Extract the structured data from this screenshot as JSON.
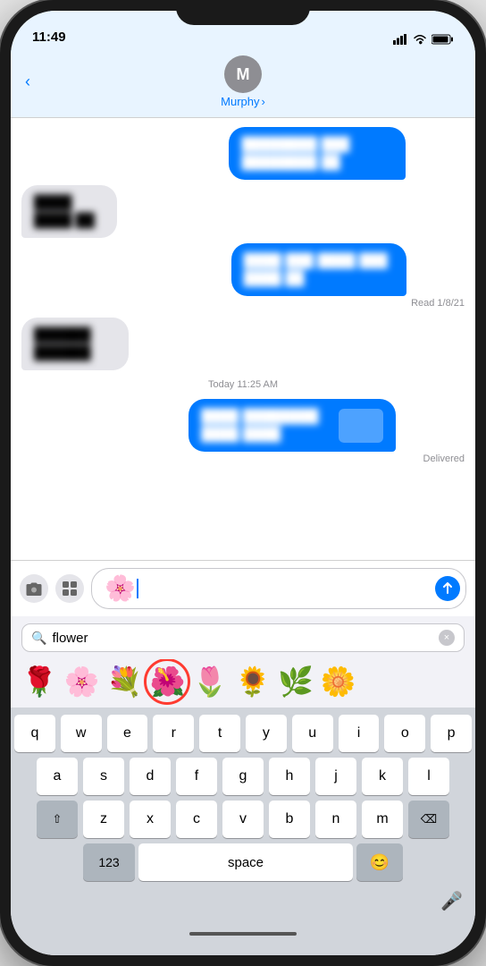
{
  "status": {
    "time": "11:49",
    "signal": "signal",
    "wifi": "wifi",
    "battery": "battery"
  },
  "nav": {
    "back_label": "‹",
    "avatar_letter": "M",
    "contact_name": "Murphy",
    "name_arrow": "›"
  },
  "messages": [
    {
      "id": 1,
      "type": "sent",
      "blurred": true,
      "text": "blurred sent message 1"
    },
    {
      "id": 2,
      "type": "received",
      "blurred": true,
      "text": "blurred received message 1"
    },
    {
      "id": 3,
      "type": "sent",
      "blurred": true,
      "text": "blurred sent message 2"
    },
    {
      "id": 4,
      "type": "meta",
      "text": "Read 1/8/21"
    },
    {
      "id": 5,
      "type": "received",
      "blurred": true,
      "text": "blurred received message 2"
    },
    {
      "id": 6,
      "type": "meta_center",
      "text": "Today 11:25 AM"
    },
    {
      "id": 7,
      "type": "sent",
      "blurred": true,
      "text": "blurred sent message 3 long"
    },
    {
      "id": 8,
      "type": "delivered",
      "text": "Delivered"
    }
  ],
  "compose": {
    "flower_emoji": "🌸",
    "send_icon": "↑"
  },
  "compose_icons": {
    "camera_icon": "⊙",
    "appstore_icon": "A"
  },
  "emoji_search": {
    "placeholder": "flower",
    "search_icon": "🔍",
    "clear_icon": "×"
  },
  "emoji_results": [
    {
      "emoji": "🌹",
      "highlighted": false
    },
    {
      "emoji": "🌸",
      "highlighted": false
    },
    {
      "emoji": "💐",
      "highlighted": false
    },
    {
      "emoji": "🌺",
      "highlighted": true
    },
    {
      "emoji": "🌷",
      "highlighted": false
    },
    {
      "emoji": "🌻",
      "highlighted": false
    },
    {
      "emoji": "🌿",
      "highlighted": false
    },
    {
      "emoji": "🌼",
      "highlighted": false
    }
  ],
  "keyboard": {
    "rows": [
      [
        "q",
        "w",
        "e",
        "r",
        "t",
        "y",
        "u",
        "i",
        "o",
        "p"
      ],
      [
        "a",
        "s",
        "d",
        "f",
        "g",
        "h",
        "j",
        "k",
        "l"
      ],
      [
        "⇧",
        "z",
        "x",
        "c",
        "v",
        "b",
        "n",
        "m",
        "⌫"
      ],
      [
        "123",
        "space",
        "😊"
      ]
    ],
    "space_label": "space",
    "num_label": "123",
    "mic_icon": "🎤"
  }
}
